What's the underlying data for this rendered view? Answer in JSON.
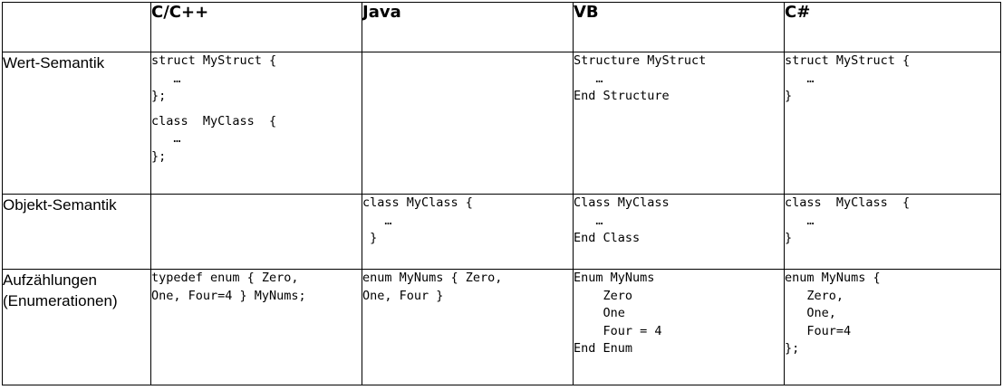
{
  "header": {
    "corner": "",
    "columns": [
      "C/C++",
      "Java",
      "VB",
      "C#"
    ]
  },
  "rows": [
    {
      "label": "Wert-Semantik",
      "cells": [
        [
          "struct MyStruct {",
          "   …",
          "};",
          "",
          "class  MyClass  {",
          "   …",
          "};"
        ],
        [],
        [
          "Structure MyStruct",
          "   …",
          "End Structure"
        ],
        [
          "struct MyStruct {",
          "   …",
          "}"
        ]
      ]
    },
    {
      "label": "Objekt-Semantik",
      "cells": [
        [],
        [
          "class MyClass {",
          "   …",
          " }"
        ],
        [
          "Class MyClass",
          "   …",
          "End Class"
        ],
        [
          "class  MyClass  {",
          "   …",
          "}"
        ]
      ]
    },
    {
      "label_lines": [
        "Aufzählungen",
        "(Enumerationen)"
      ],
      "cells": [
        [
          "typedef enum { Zero,",
          "One, Four=4 } MyNums;"
        ],
        [
          "enum MyNums { Zero,",
          "One, Four }"
        ],
        [
          "Enum MyNums",
          "    Zero",
          "    One",
          "    Four = 4",
          "End Enum"
        ],
        [
          "enum MyNums {",
          "   Zero,",
          "   One,",
          "   Four=4",
          "};"
        ]
      ]
    }
  ]
}
